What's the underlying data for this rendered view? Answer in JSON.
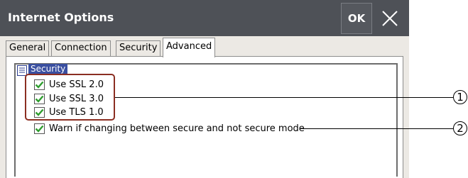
{
  "window": {
    "title": "Internet Options",
    "ok_label": "OK"
  },
  "tabs": [
    {
      "label": "General",
      "active": false
    },
    {
      "label": "Connection",
      "active": false
    },
    {
      "label": "Security",
      "active": false
    },
    {
      "label": "Advanced",
      "active": true
    }
  ],
  "list": {
    "group_label": "Security",
    "options": [
      {
        "label": "Use SSL 2.0",
        "checked": true
      },
      {
        "label": "Use SSL 3.0",
        "checked": true
      },
      {
        "label": "Use TLS 1.0",
        "checked": true
      },
      {
        "label": "Warn if changing between secure and not secure mode",
        "checked": true
      }
    ]
  },
  "callouts": [
    {
      "number": "1"
    },
    {
      "number": "2"
    }
  ],
  "colors": {
    "titlebar": "#4e5157",
    "check": "#2e9d2e",
    "highlight": "#8b2e22",
    "selection": "#3a4fa0"
  }
}
